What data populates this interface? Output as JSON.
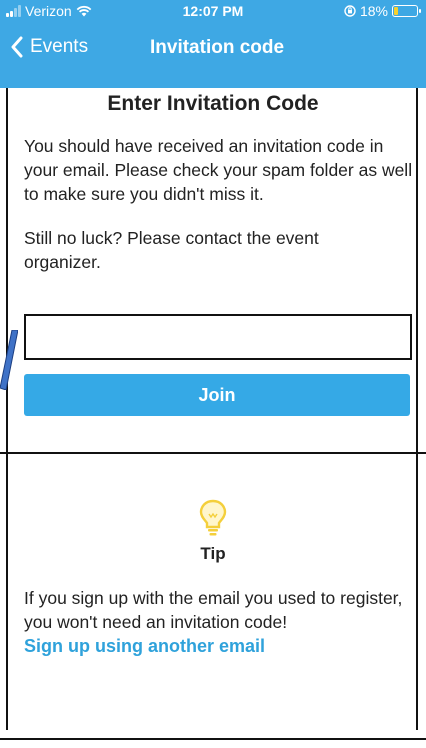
{
  "status_bar": {
    "carrier": "Verizon",
    "time": "12:07 PM",
    "battery_percent": "18%",
    "battery_level": 0.18,
    "signal_bars": 2
  },
  "nav": {
    "back_label": "Events",
    "title": "Invitation code"
  },
  "main": {
    "heading": "Enter Invitation Code",
    "paragraph1": "You should have received an invitation code in your email. Please check your spam folder as well to make sure you didn't miss it.",
    "paragraph2": "Still no luck? Please contact the event organizer.",
    "code_input_value": "",
    "join_label": "Join"
  },
  "tip": {
    "icon": "lightbulb-icon",
    "title": "Tip",
    "text": "If you sign up with the email you used to register, you won't need an invitation code!",
    "link": "Sign up using another email"
  },
  "colors": {
    "accent": "#3ea8e4",
    "button": "#35a9e6",
    "link": "#2fa2db",
    "bulb": "#f4cf3b",
    "battery_low": "#f6d02e"
  }
}
